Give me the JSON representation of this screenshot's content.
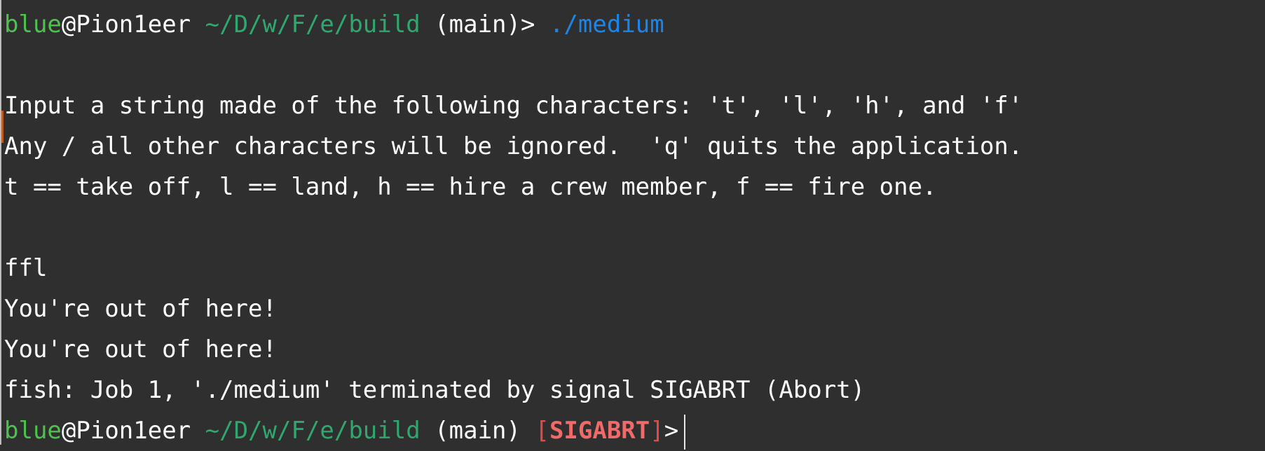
{
  "prompt1": {
    "user": "blue",
    "at": "@",
    "host": "Pion1eer",
    "cwd": "~/D/w/F/e/build",
    "branch": "(main)",
    "symbol": ">",
    "command": "./medium"
  },
  "output": {
    "line1": "Input a string made of the following characters: 't', 'l', 'h', and 'f'",
    "line2": "Any / all other characters will be ignored.  'q' quits the application.",
    "line3": "t == take off, l == land, h == hire a crew member, f == fire one.",
    "input": "ffl",
    "line4": "You're out of here!",
    "line5": "You're out of here!",
    "line6": "fish: Job 1, './medium' terminated by signal SIGABRT (Abort)"
  },
  "prompt2": {
    "user": "blue",
    "at": "@",
    "host": "Pion1eer",
    "cwd": "~/D/w/F/e/build",
    "branch": "(main)",
    "status_open": "[",
    "status": "SIGABRT",
    "status_close": "]",
    "symbol": ">"
  },
  "colors": {
    "background": "#2f2f2f",
    "user": "#4ec24e",
    "cwd": "#2ea86f",
    "command": "#1c86e8",
    "error": "#f06a6a"
  }
}
